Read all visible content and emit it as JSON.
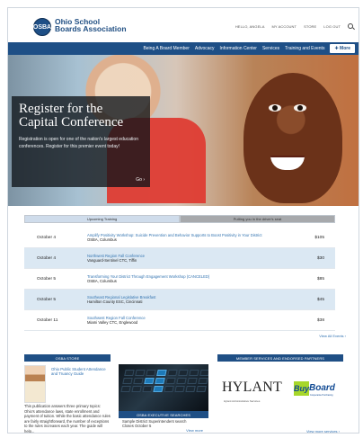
{
  "header": {
    "logo_mark": "OSBA",
    "site_name_1": "Ohio School",
    "site_name_2": "Boards Association",
    "top_links": [
      "Hello, Angela",
      "MY ACCOUNT",
      "STORE",
      "LOG OUT"
    ]
  },
  "main_nav": {
    "items": [
      "Being A Board Member",
      "Advocacy",
      "Information Center",
      "Services",
      "Training and Events"
    ],
    "more_label": "More",
    "more_icon": "plus-icon"
  },
  "hero": {
    "title_1": "Register for the",
    "title_2": "Capital Conference",
    "description": "Registration is open for one of the nation's largest education conferences. Register for this premier event today!",
    "go_label": "Go ›"
  },
  "training": {
    "tabs": [
      "Upcoming Training",
      "Putting you in the driver's seat"
    ],
    "rows": [
      {
        "date": "October 4",
        "title": "Amplify Positivity Workshop: Suicide Prevention and Behavior Supports to Boost Positivity in Your District",
        "location": "OSBA, Columbus",
        "price": "$105"
      },
      {
        "date": "October 4",
        "title": "Northwest Region Fall Conference",
        "location": "Vanguard-Sentinel CTC, Tiffin",
        "price": "$30"
      },
      {
        "date": "October 5",
        "title": "Transforming Your District Through Engagement Workshop (CANCELED)",
        "location": "OSBA, Columbus",
        "price": "$85"
      },
      {
        "date": "October 5",
        "title": "Southeast Regional Legislative Breakfast",
        "location": "Hamilton County ESC, Cincinnati",
        "price": "$45"
      },
      {
        "date": "October 11",
        "title": "Southwest Region Fall Conference",
        "location": "Miami Valley CTC, Englewood",
        "price": "$38"
      }
    ],
    "view_all": "View All Events ›"
  },
  "lower": {
    "store": {
      "bar": "OSBA STORE",
      "title": "Ohio Public Student Attendance and Truancy Guide",
      "text": "This publication answers three primary topics: Ohio's attendance laws, state enrollment and payment of tuition. While the basic attendance rules are fairly straightforward, the number of exceptions to the rules increases each year. The guide will help..."
    },
    "exec": {
      "bar": "OSBA EXECUTIVE SEARCHES",
      "title": "Sample District Superintendent search",
      "subtitle": "Closes October 5",
      "more": "View more"
    },
    "partners": {
      "bar": "MEMBER SERVICES AND ENDORSED PARTNERS",
      "hylant": "HYLANT",
      "hylant_sub": "Hylant Administrative Services",
      "buy": "Buy",
      "board": "Board",
      "buy_sub": "Cooperative Purchasing",
      "more": "View more services ›"
    }
  },
  "colors": {
    "brand": "#1e4f86",
    "accent": "#2d6fb0",
    "tab_active": "#cfdceb"
  }
}
